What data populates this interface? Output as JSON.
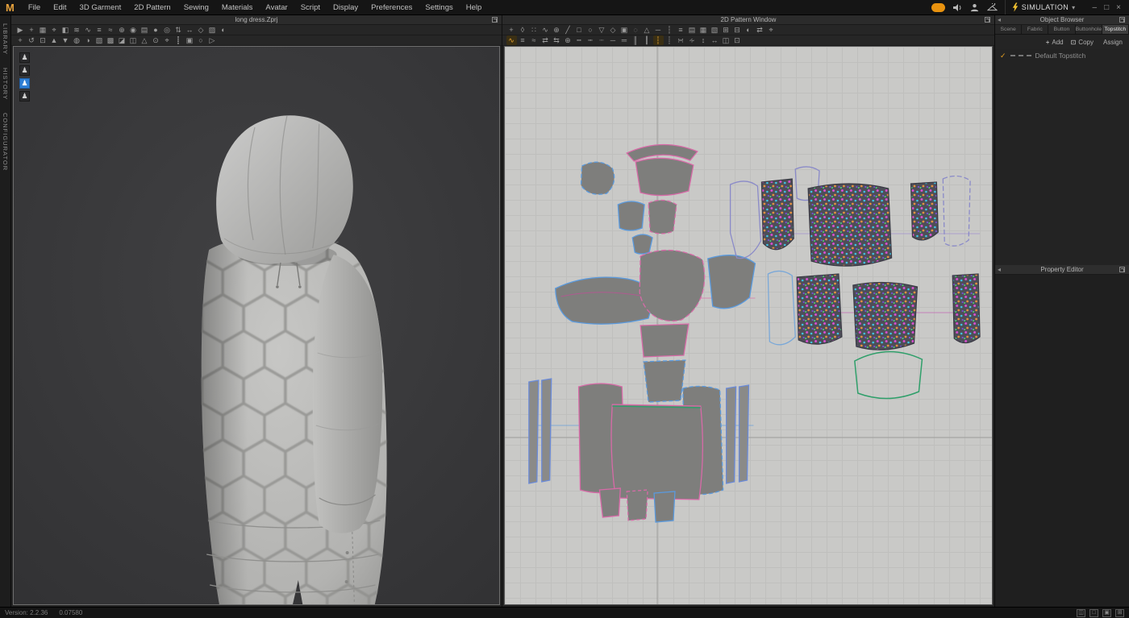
{
  "app": {
    "logo": "M",
    "window3d_title": "long dress.Zprj",
    "window2d_title": "2D Pattern Window"
  },
  "menubar": {
    "items": [
      {
        "id": "menu-file",
        "label": "File"
      },
      {
        "id": "menu-edit",
        "label": "Edit"
      },
      {
        "id": "menu-3d-garment",
        "label": "3D Garment"
      },
      {
        "id": "menu-2d-pattern",
        "label": "2D Pattern"
      },
      {
        "id": "menu-sewing",
        "label": "Sewing"
      },
      {
        "id": "menu-materials",
        "label": "Materials"
      },
      {
        "id": "menu-avatar",
        "label": "Avatar"
      },
      {
        "id": "menu-script",
        "label": "Script"
      },
      {
        "id": "menu-display",
        "label": "Display"
      },
      {
        "id": "menu-preferences",
        "label": "Preferences"
      },
      {
        "id": "menu-settings",
        "label": "Settings"
      },
      {
        "id": "menu-help",
        "label": "Help"
      }
    ],
    "simulation_label": "SIMULATION",
    "simulation_caret": "▾",
    "window_controls": [
      {
        "id": "minimize-button",
        "glyph": "–"
      },
      {
        "id": "maximize-button",
        "glyph": "□"
      },
      {
        "id": "close-button",
        "glyph": "×"
      }
    ]
  },
  "left_rail": {
    "items": [
      {
        "id": "rail-library",
        "label": "LIBRARY"
      },
      {
        "id": "rail-history",
        "label": "HISTORY"
      },
      {
        "id": "rail-configurator",
        "label": "CONFIGURATOR"
      }
    ]
  },
  "toolbar_3d_row1": [
    {
      "id": "simulate-icon",
      "glyph": "▶"
    },
    {
      "id": "select-move-icon",
      "glyph": "+"
    },
    {
      "id": "select-mesh-icon",
      "glyph": "▦"
    },
    {
      "id": "pin-icon",
      "glyph": "⌖"
    },
    {
      "id": "fold-arrangement-icon",
      "glyph": "◧"
    },
    {
      "id": "wind-controller-icon",
      "glyph": "≋"
    },
    {
      "id": "sewing-edit-icon",
      "glyph": "∿"
    },
    {
      "id": "segment-sewing-icon",
      "glyph": "≡"
    },
    {
      "id": "free-sewing-icon",
      "glyph": "≈"
    },
    {
      "id": "detail-sewing-icon",
      "glyph": "⊕"
    },
    {
      "id": "tack-icon",
      "glyph": "◉"
    },
    {
      "id": "grading-icon",
      "glyph": "▤"
    },
    {
      "id": "button-icon",
      "glyph": "●"
    },
    {
      "id": "buttonhole-icon",
      "glyph": "◎"
    },
    {
      "id": "zipper-icon",
      "glyph": "⇅"
    },
    {
      "id": "measure-icon",
      "glyph": "↔"
    },
    {
      "id": "flatten-icon",
      "glyph": "◇"
    },
    {
      "id": "texture-view-icon",
      "glyph": "▨"
    },
    {
      "id": "render-icon",
      "glyph": "◐"
    }
  ],
  "toolbar_3d_row2": [
    {
      "id": "gizmo-move-icon",
      "glyph": "+"
    },
    {
      "id": "gizmo-rotate-icon",
      "glyph": "↺"
    },
    {
      "id": "gizmo-scale-icon",
      "glyph": "⊡"
    },
    {
      "id": "view-front-icon",
      "glyph": "▲"
    },
    {
      "id": "view-back-icon",
      "glyph": "▼"
    },
    {
      "id": "show-avatar-icon",
      "glyph": "◍"
    },
    {
      "id": "show-garment-icon",
      "glyph": "◑"
    },
    {
      "id": "surface-view-icon",
      "glyph": "▧"
    },
    {
      "id": "mesh-view-icon",
      "glyph": "▩"
    },
    {
      "id": "strain-map-icon",
      "glyph": "◪"
    },
    {
      "id": "stress-map-icon",
      "glyph": "◫"
    },
    {
      "id": "fit-map-icon",
      "glyph": "△"
    },
    {
      "id": "pressure-view-icon",
      "glyph": "⊙"
    },
    {
      "id": "show-pins-icon",
      "glyph": "⌖"
    },
    {
      "id": "show-stitch-icon",
      "glyph": "┋"
    },
    {
      "id": "camera-view-icon",
      "glyph": "▣"
    },
    {
      "id": "light-setting-icon",
      "glyph": "○"
    },
    {
      "id": "snapshot-icon",
      "glyph": "▷"
    }
  ],
  "toolbar_2d_row1": [
    {
      "id": "transform-pattern-icon",
      "glyph": "+"
    },
    {
      "id": "edit-pattern-icon",
      "glyph": "◊"
    },
    {
      "id": "edit-point-icon",
      "glyph": "∷"
    },
    {
      "id": "edit-curvature-icon",
      "glyph": "∿"
    },
    {
      "id": "add-point-icon",
      "glyph": "⊕"
    },
    {
      "id": "polygon-pen-icon",
      "glyph": "╱"
    },
    {
      "id": "rectangle-pen-icon",
      "glyph": "□"
    },
    {
      "id": "circle-pen-icon",
      "glyph": "○"
    },
    {
      "id": "dart-icon",
      "glyph": "▽"
    },
    {
      "id": "internal-polygon-icon",
      "glyph": "◇"
    },
    {
      "id": "internal-rectangle-icon",
      "glyph": "▣"
    },
    {
      "id": "internal-circle-icon",
      "glyph": "◌"
    },
    {
      "id": "internal-dart-icon",
      "glyph": "△"
    },
    {
      "id": "baseline-icon",
      "glyph": "─"
    },
    {
      "id": "notch-icon",
      "glyph": "┆"
    },
    {
      "id": "seam-allowance-icon",
      "glyph": "≡"
    },
    {
      "id": "grading-edit-icon",
      "glyph": "▤"
    },
    {
      "id": "texture-editor-icon",
      "glyph": "▦"
    },
    {
      "id": "print-layout-icon",
      "glyph": "▧"
    },
    {
      "id": "align-grid-icon",
      "glyph": "⊞"
    },
    {
      "id": "unfold-icon",
      "glyph": "⊟"
    },
    {
      "id": "symmetry-icon",
      "glyph": "◐"
    },
    {
      "id": "flip-icon",
      "glyph": "⇄"
    },
    {
      "id": "snap-icon",
      "glyph": "⌖"
    }
  ],
  "toolbar_2d_row2": [
    {
      "id": "edit-sewing-icon",
      "glyph": "∿",
      "active": true
    },
    {
      "id": "segment-sewing-2d-icon",
      "glyph": "≡"
    },
    {
      "id": "free-sewing-2d-icon",
      "glyph": "≈"
    },
    {
      "id": "mn-segment-sewing-icon",
      "glyph": "⇄"
    },
    {
      "id": "mn-free-sewing-icon",
      "glyph": "⇆"
    },
    {
      "id": "detail-sewing-2d-icon",
      "glyph": "⊕"
    },
    {
      "id": "edit-puckering-icon",
      "glyph": "┅"
    },
    {
      "id": "segment-puckering-icon",
      "glyph": "┉"
    },
    {
      "id": "free-puckering-icon",
      "glyph": "┈"
    },
    {
      "id": "seam-taping-icon",
      "glyph": "─"
    },
    {
      "id": "fuse-tape-icon",
      "glyph": "═"
    },
    {
      "id": "elastic-icon",
      "glyph": "║"
    },
    {
      "id": "bind-icon",
      "glyph": "┃"
    },
    {
      "id": "edit-topstitch-icon",
      "glyph": "┆",
      "active": true
    },
    {
      "id": "segment-topstitch-icon",
      "glyph": "┊"
    },
    {
      "id": "free-topstitch-icon",
      "glyph": "∺"
    },
    {
      "id": "piping-icon",
      "glyph": "∻"
    },
    {
      "id": "zipper-edit-icon",
      "glyph": "↕"
    },
    {
      "id": "measure-2d-icon",
      "glyph": "↔"
    },
    {
      "id": "annotation-icon",
      "glyph": "◫"
    },
    {
      "id": "layout-icon",
      "glyph": "⊡"
    }
  ],
  "avatar_toggles": [
    {
      "id": "avatar-display-toggle-1",
      "glyph": "♟"
    },
    {
      "id": "avatar-display-toggle-2",
      "glyph": "♟"
    },
    {
      "id": "avatar-display-toggle-3",
      "glyph": "♟",
      "active": true
    },
    {
      "id": "avatar-display-toggle-4",
      "glyph": "♟"
    }
  ],
  "object_browser": {
    "title": "Object Browser",
    "tabs": [
      {
        "id": "tab-scene",
        "label": "Scene"
      },
      {
        "id": "tab-fabric",
        "label": "Fabric"
      },
      {
        "id": "tab-button",
        "label": "Button"
      },
      {
        "id": "tab-buttonhole",
        "label": "Buttonhole"
      },
      {
        "id": "tab-topstitch",
        "label": "Topstitch",
        "active": true
      }
    ],
    "actions": [
      {
        "id": "add-button",
        "icon": "+",
        "label": "Add"
      },
      {
        "id": "copy-button",
        "icon": "⊡",
        "label": "Copy"
      },
      {
        "id": "assign-button",
        "icon": "",
        "label": "Assign"
      }
    ],
    "rows": [
      {
        "id": "topstitch-list-item",
        "check": "✓",
        "label": "Default Topstitch"
      }
    ]
  },
  "property_editor": {
    "title": "Property Editor"
  },
  "statusbar": {
    "version": "Version: 2.2.36",
    "counter": "0.07580",
    "icons": [
      {
        "id": "layout-3d2d-icon",
        "glyph": "◫"
      },
      {
        "id": "layout-3d-only-icon",
        "glyph": "□"
      },
      {
        "id": "layout-2d-only-icon",
        "glyph": "▣"
      },
      {
        "id": "layout-quad-icon",
        "glyph": "⊞"
      }
    ]
  },
  "colors": {
    "accent_orange": "#e8a33d",
    "selected_blue": "#2f7fd6",
    "seam_pink": "#d86aa8",
    "seam_blue": "#5a9ade",
    "seam_green": "#2f9f6a"
  }
}
